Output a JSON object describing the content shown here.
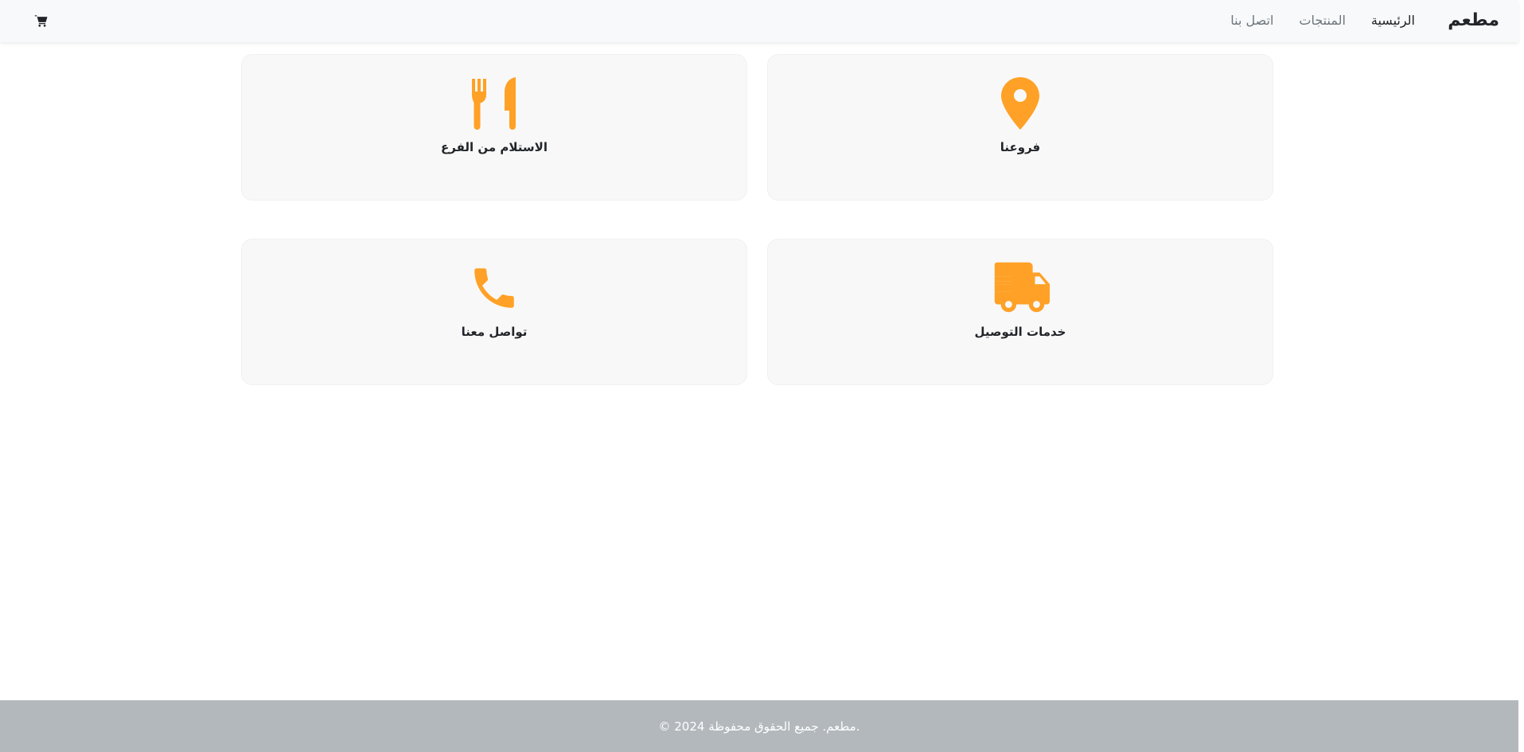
{
  "navbar": {
    "brand": "مطعم",
    "links": [
      {
        "label": "الرئيسية",
        "active": true
      },
      {
        "label": "المنتجات",
        "active": false
      },
      {
        "label": "اتصل بنا",
        "active": false
      }
    ],
    "cart_icon": "cart-icon"
  },
  "cards": [
    {
      "label": "فروعنا",
      "icon": "map-pin-icon"
    },
    {
      "label": "الاستلام من الفرع",
      "icon": "utensils-icon"
    },
    {
      "label": "خدمات التوصيل",
      "icon": "delivery-truck-icon"
    },
    {
      "label": "تواصل معنا",
      "icon": "phone-icon"
    }
  ],
  "footer": {
    "text": "© 2024 مطعم. جميع الحقوق محفوظة."
  },
  "colors": {
    "accent": "#ffa126",
    "navbar_bg": "#f8f9fa",
    "card_bg": "#f8f8f8",
    "footer_bg": "#b3b8bc"
  }
}
